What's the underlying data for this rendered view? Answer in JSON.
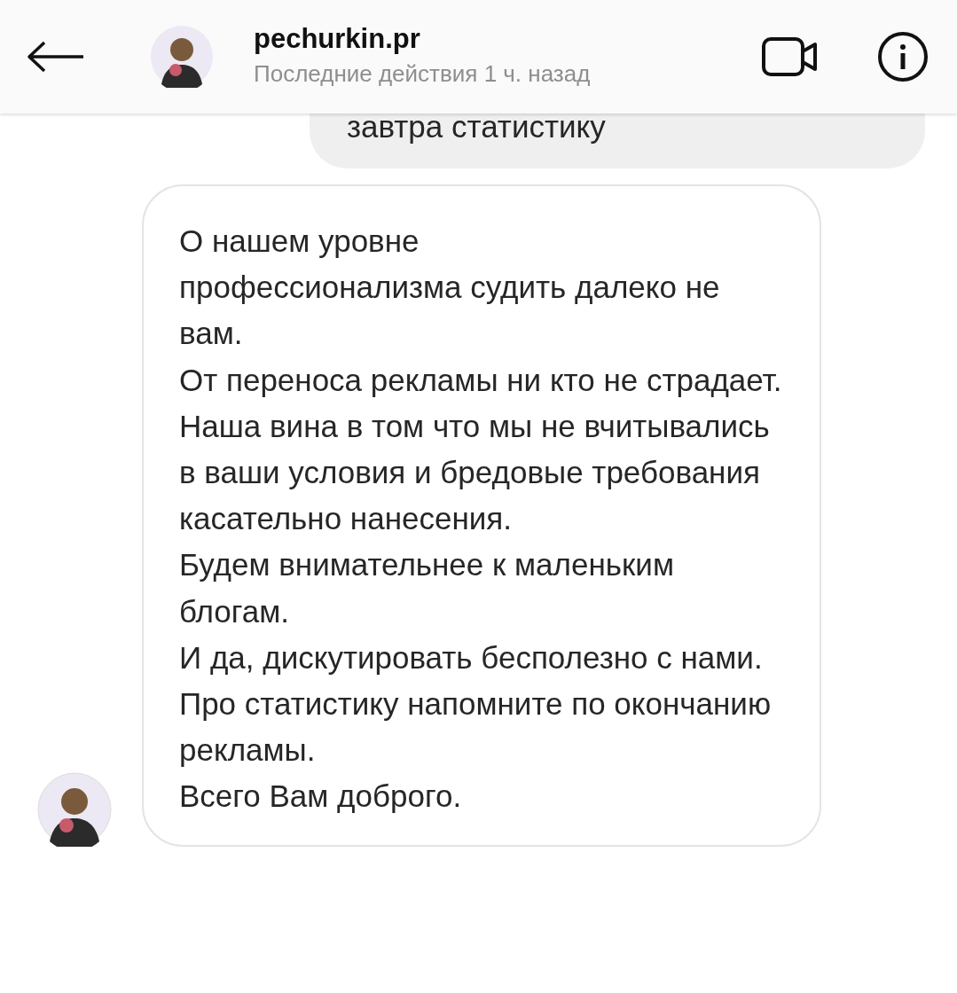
{
  "header": {
    "username": "pechurkin.pr",
    "status": "Последние действия 1 ч. назад"
  },
  "messages": [
    {
      "kind": "sent",
      "text": "завтра статистику"
    },
    {
      "kind": "received",
      "text": "О нашем уровне\nпрофессионализма судить далеко не вам.\nОт переноса рекламы ни кто не страдает.\nНаша вина в том что мы не вчитывались в ваши условия и бредовые требования касательно нанесения.\nБудем внимательнее к маленьким блогам.\nИ да, дискутировать бесполезно с нами.\nПро статистику напомните по окончанию рекламы.\nВсего Вам доброго."
    }
  ]
}
